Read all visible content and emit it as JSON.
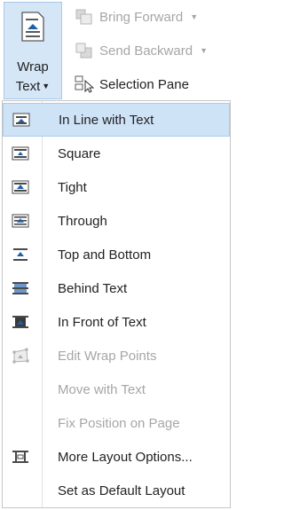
{
  "ribbon": {
    "wrap_text": {
      "line1": "Wrap",
      "line2": "Text"
    },
    "bring_forward": "Bring Forward",
    "send_backward": "Send Backward",
    "selection_pane": "Selection Pane"
  },
  "menu": {
    "items": [
      {
        "label": "In Line with Text",
        "icon": "inline-with-text-icon",
        "enabled": true,
        "selected": true
      },
      {
        "label": "Square",
        "icon": "square-wrap-icon",
        "enabled": true
      },
      {
        "label": "Tight",
        "icon": "tight-wrap-icon",
        "enabled": true
      },
      {
        "label": "Through",
        "icon": "through-wrap-icon",
        "enabled": true
      },
      {
        "label": "Top and Bottom",
        "icon": "top-bottom-wrap-icon",
        "enabled": true
      },
      {
        "label": "Behind Text",
        "icon": "behind-text-icon",
        "enabled": true
      },
      {
        "label": "In Front of Text",
        "icon": "in-front-of-text-icon",
        "enabled": true
      },
      {
        "label": "Edit Wrap Points",
        "icon": "edit-wrap-points-icon",
        "enabled": false
      },
      {
        "label": "Move with Text",
        "icon": "",
        "enabled": false
      },
      {
        "label": "Fix Position on Page",
        "icon": "",
        "enabled": false
      },
      {
        "label": "More Layout Options...",
        "icon": "layout-options-icon",
        "enabled": true
      },
      {
        "label": "Set as Default Layout",
        "icon": "",
        "enabled": true
      }
    ]
  },
  "colors": {
    "accent": "#1f5fa9",
    "selected_bg": "#cfe3f7",
    "disabled_text": "#a6a6a6"
  }
}
